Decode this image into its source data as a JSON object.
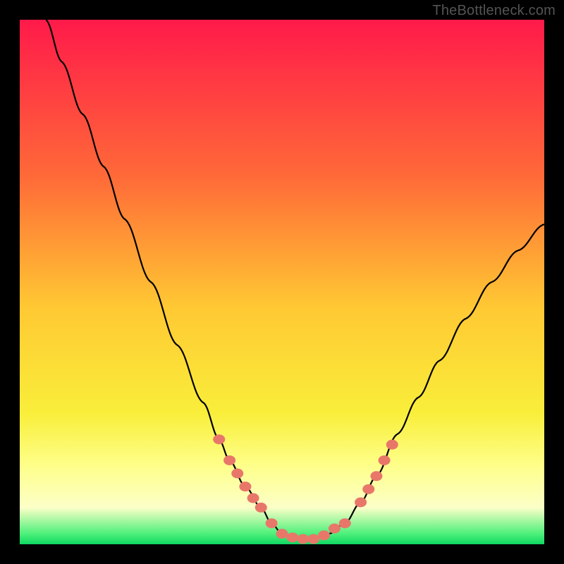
{
  "watermark": "TheBottleneck.com",
  "chart_data": {
    "type": "line",
    "title": "",
    "xlabel": "",
    "ylabel": "",
    "xlim": [
      0,
      100
    ],
    "ylim": [
      0,
      100
    ],
    "background_gradient": {
      "stops": [
        {
          "offset": 0.0,
          "color": "#ff1a4a"
        },
        {
          "offset": 0.3,
          "color": "#ff6a38"
        },
        {
          "offset": 0.55,
          "color": "#ffc933"
        },
        {
          "offset": 0.75,
          "color": "#f9ee3a"
        },
        {
          "offset": 0.85,
          "color": "#feff8a"
        },
        {
          "offset": 0.93,
          "color": "#fcffc7"
        },
        {
          "offset": 0.98,
          "color": "#4df07a"
        },
        {
          "offset": 1.0,
          "color": "#0fd862"
        }
      ]
    },
    "series": [
      {
        "name": "bottleneck-curve",
        "color": "#000000",
        "points": [
          {
            "x": 5,
            "y": 100
          },
          {
            "x": 8,
            "y": 92
          },
          {
            "x": 12,
            "y": 82
          },
          {
            "x": 16,
            "y": 72
          },
          {
            "x": 20,
            "y": 62
          },
          {
            "x": 25,
            "y": 50
          },
          {
            "x": 30,
            "y": 38
          },
          {
            "x": 35,
            "y": 27
          },
          {
            "x": 38,
            "y": 20
          },
          {
            "x": 40,
            "y": 16
          },
          {
            "x": 43,
            "y": 11
          },
          {
            "x": 46,
            "y": 7
          },
          {
            "x": 48,
            "y": 4
          },
          {
            "x": 50,
            "y": 2
          },
          {
            "x": 53,
            "y": 1
          },
          {
            "x": 56,
            "y": 1
          },
          {
            "x": 59,
            "y": 2
          },
          {
            "x": 62,
            "y": 4
          },
          {
            "x": 65,
            "y": 8
          },
          {
            "x": 68,
            "y": 13
          },
          {
            "x": 72,
            "y": 21
          },
          {
            "x": 76,
            "y": 28
          },
          {
            "x": 80,
            "y": 35
          },
          {
            "x": 85,
            "y": 43
          },
          {
            "x": 90,
            "y": 50
          },
          {
            "x": 95,
            "y": 56
          },
          {
            "x": 100,
            "y": 61
          }
        ]
      }
    ],
    "highlight_markers": {
      "color": "#e8776a",
      "points": [
        {
          "x": 38,
          "y": 20
        },
        {
          "x": 40,
          "y": 16
        },
        {
          "x": 41.5,
          "y": 13.5
        },
        {
          "x": 43,
          "y": 11
        },
        {
          "x": 44.5,
          "y": 8.8
        },
        {
          "x": 46,
          "y": 7
        },
        {
          "x": 48,
          "y": 4
        },
        {
          "x": 50,
          "y": 2
        },
        {
          "x": 52,
          "y": 1.3
        },
        {
          "x": 54,
          "y": 1
        },
        {
          "x": 56,
          "y": 1
        },
        {
          "x": 58,
          "y": 1.7
        },
        {
          "x": 60,
          "y": 3
        },
        {
          "x": 62,
          "y": 4
        },
        {
          "x": 65,
          "y": 8
        },
        {
          "x": 66.5,
          "y": 10.5
        },
        {
          "x": 68,
          "y": 13
        },
        {
          "x": 69.5,
          "y": 16
        },
        {
          "x": 71,
          "y": 19
        }
      ]
    },
    "frame": {
      "outer_border_width": 28,
      "outer_border_color": "#000000"
    }
  }
}
